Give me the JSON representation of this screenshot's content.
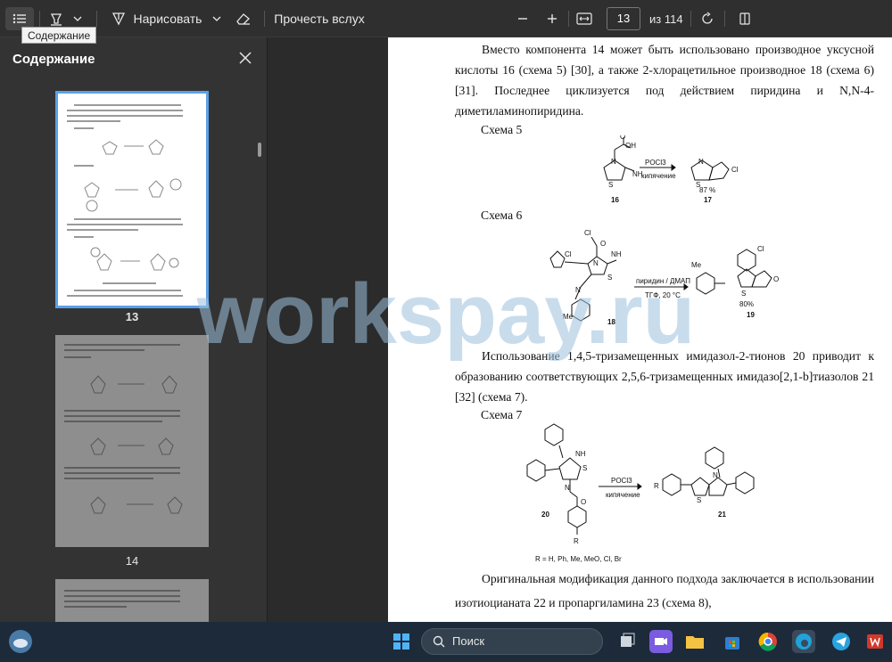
{
  "toolbar": {
    "draw_label": "Нарисовать",
    "read_aloud_label": "Прочесть вслух",
    "current_page": "13",
    "page_total": "из 114",
    "tooltip": "Содержание"
  },
  "sidebar": {
    "title": "Содержание",
    "thumbnails": [
      {
        "label": "13",
        "selected": true
      },
      {
        "label": "14",
        "selected": false
      }
    ]
  },
  "document": {
    "para1": "Вместо компонента 14 может быть использовано производное уксусной кислоты 16 (схема 5) [30], а также 2-хлорацетильное производное 18 (схема 6) [31]. Последнее циклизуется под действием пиридина и N,N-4-диметиламинопиридина.",
    "scheme5_caption": "Схема 5",
    "scheme5": {
      "reagent": "POCl3",
      "condition": "кипячение",
      "yield": "87 %",
      "reactant_number": "16",
      "product_number": "17",
      "oh_label": "OH",
      "o_label": "O",
      "n_label": "N",
      "s_label": "S",
      "nh_label": "NH",
      "cl_label": "Cl"
    },
    "scheme6_caption": "Схема 6",
    "scheme6": {
      "reagent": "пиридин / ДМАП",
      "condition": "ТГФ, 20 °С",
      "yield": "80%",
      "reactant_number": "18",
      "product_number": "19",
      "cl_label": "Cl",
      "me_label": "Me",
      "nh_label": "NH",
      "o_label": "O",
      "n_label": "N",
      "s_label": "S"
    },
    "para2": "Использование 1,4,5-тризамещенных имидазол-2-тионов 20 приводит к образованию соответствующих 2,5,6-тризамещенных имидазо[2,1-b]тиазолов 21 [32] (схема 7).",
    "scheme7_caption": "Схема 7",
    "scheme7": {
      "reagent": "POCl3",
      "condition": "кипячение",
      "reactant_number": "20",
      "product_number": "21",
      "substituents": "R = H, Ph, Me, MeO, Cl, Br",
      "r_label": "R",
      "nh_label": "NH",
      "s_label": "S",
      "o_label": "O",
      "n_label": "N"
    },
    "para3": "Оригинальная модификация данного подхода заключается в использовании изотиоцианата 22 и пропаргиламина 23 (схема 8),"
  },
  "watermark": "workspay.ru",
  "taskbar": {
    "search_label": "Поиск"
  },
  "colors": {
    "accent": "#5aa0e8",
    "toolbar_bg": "#2f2f2f",
    "sidebar_bg": "#333333",
    "watermark": "#9ac0dc"
  }
}
